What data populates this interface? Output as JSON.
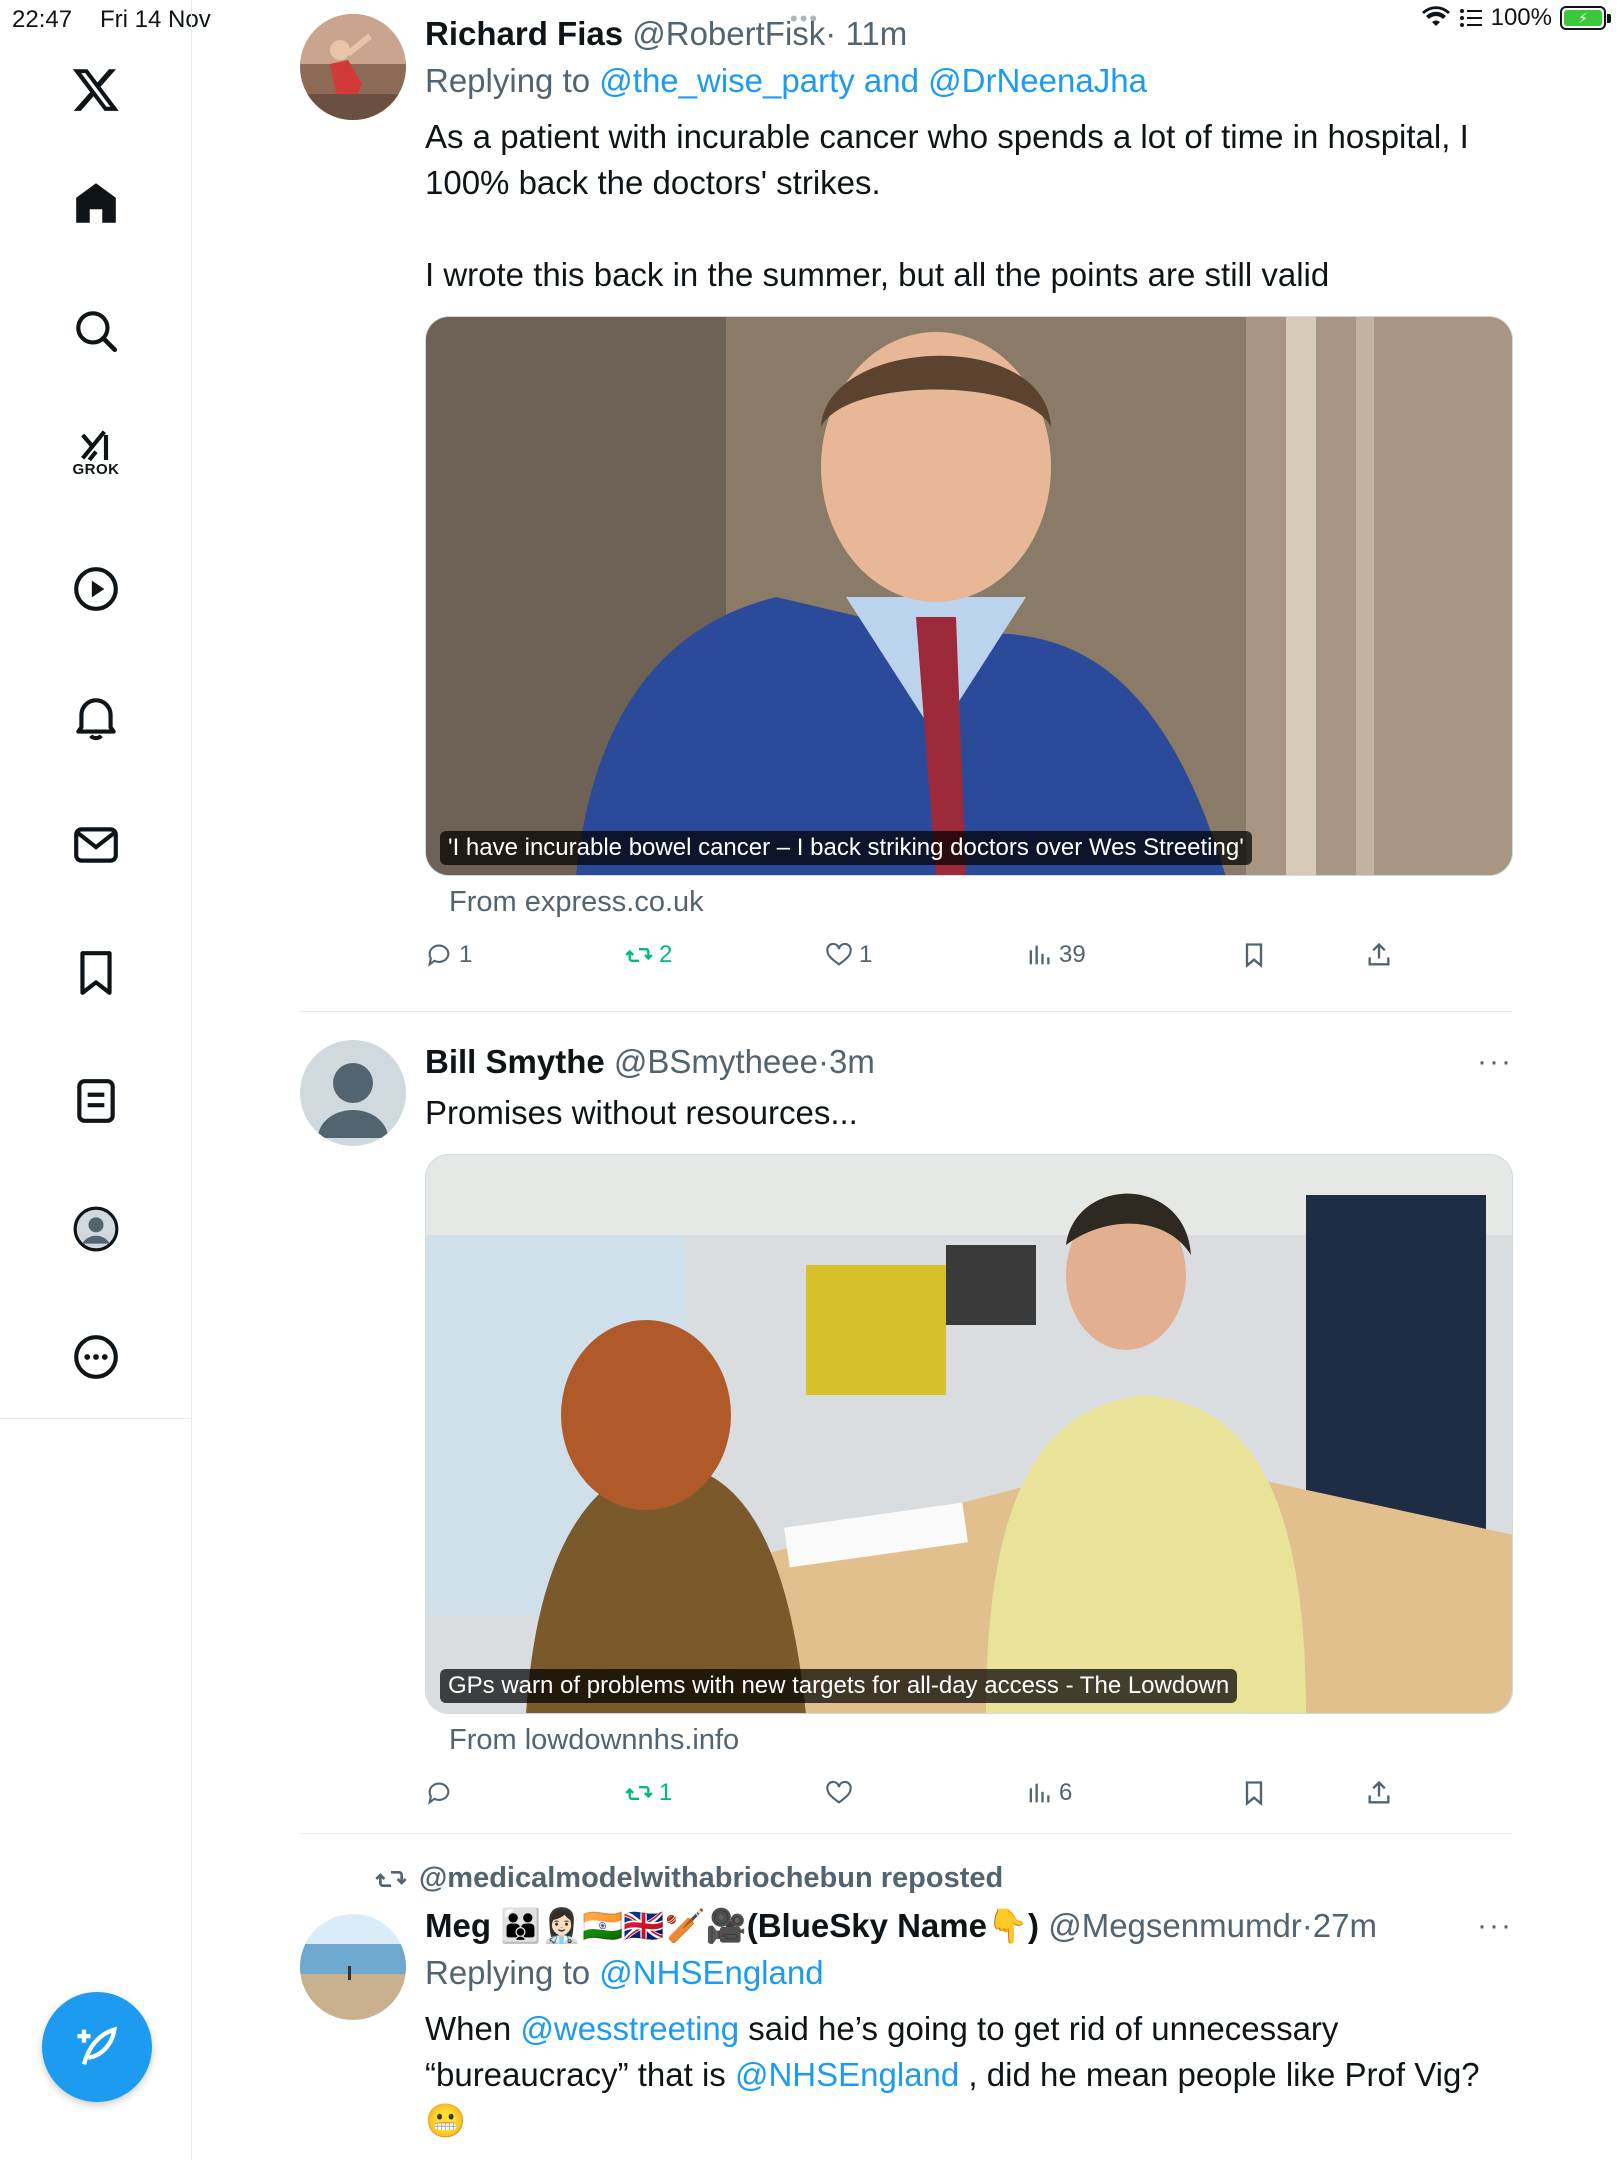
{
  "status_bar": {
    "time": "22:47",
    "date": "Fri 14 Nov",
    "battery": "100%",
    "dots": "•••"
  },
  "sidebar": {
    "items": [
      {
        "name": "x-logo-icon"
      },
      {
        "name": "home-icon"
      },
      {
        "name": "search-icon"
      },
      {
        "name": "grok-icon",
        "label": "GROK"
      },
      {
        "name": "video-icon"
      },
      {
        "name": "notifications-icon"
      },
      {
        "name": "messages-icon"
      },
      {
        "name": "bookmarks-icon"
      },
      {
        "name": "lists-icon"
      },
      {
        "name": "profile-icon"
      },
      {
        "name": "more-icon"
      }
    ],
    "compose_icon": "compose-quill-icon"
  },
  "tweets": [
    {
      "display_name": "Richard Fias",
      "handle": "@RobertFisk",
      "dot": "·",
      "time": "11m",
      "reply_prefix": "Replying to",
      "reply_to_1": "@the_wise_party",
      "reply_and": "and",
      "reply_to_2": "@DrNeenaJha",
      "text": "As a patient with incurable cancer who spends a lot of time in hospital, I 100% back the doctors' strikes.\n\nI wrote this back in the summer, but all the points are still valid",
      "card_caption": "'I have incurable bowel cancer – I back striking doctors over Wes Streeting'",
      "card_source": "From express.co.uk",
      "replies": "1",
      "reposts": "2",
      "likes": "1",
      "views": "39",
      "reposted": true
    },
    {
      "display_name": "Bill Smythe",
      "handle": "@BSmytheee",
      "dot": "·",
      "time": "3m",
      "more": "···",
      "text": "Promises without resources...",
      "card_caption": "GPs warn of problems with new targets for all-day access - The Lowdown",
      "card_source": "From lowdownnhs.info",
      "replies": "",
      "reposts": "1",
      "likes": "",
      "views": "6",
      "reposted": true
    },
    {
      "repost_by": "@medicalmodelwithabriochebun reposted",
      "display_name": "Meg 👪👩🏻‍⚕️🇮🇳🇬🇧🏏🎥(BlueSky Name👇)",
      "handle": "@Megsenmumdr",
      "dot": "·",
      "time": "27m",
      "more": "···",
      "reply_prefix": "Replying to",
      "reply_to_1": "@NHSEngland",
      "text_1": "When ",
      "mention_1": "@wesstreeting",
      "text_2": " said he’s going to get rid of unnecessary “bureaucracy” that is ",
      "mention_2": "@NHSEngland",
      "text_3": " , did he mean people like Prof Vig?",
      "emoji": "😬"
    }
  ],
  "colors": {
    "accent": "#1d9bf0",
    "repost_green": "#00ba7c",
    "secondary_text": "#536471",
    "divider": "#e7ebee"
  }
}
